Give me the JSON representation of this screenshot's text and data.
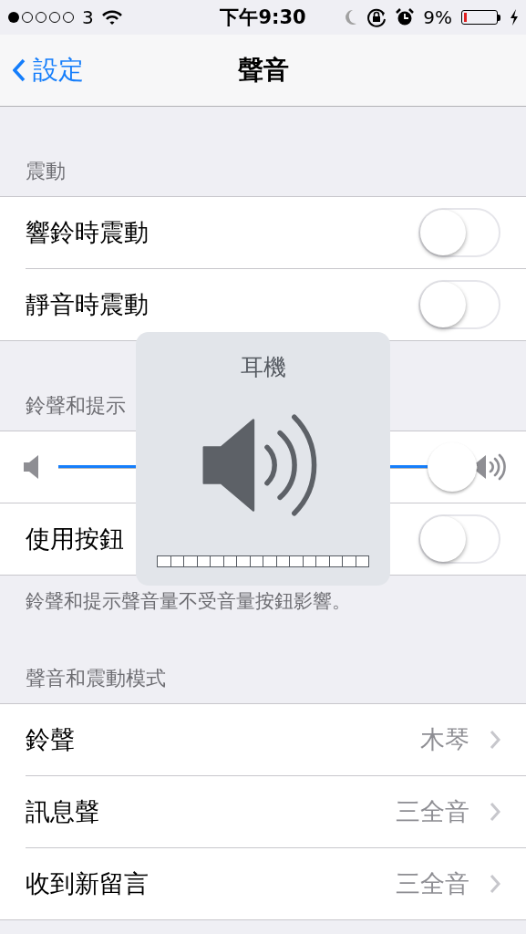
{
  "status_bar": {
    "carrier": "3",
    "time": "下午9:30",
    "battery_text": "9%",
    "charging": true
  },
  "nav": {
    "back": "設定",
    "title": "聲音"
  },
  "sections": [
    {
      "header": "震動",
      "rows": [
        {
          "kind": "toggle",
          "label": "響鈴時震動",
          "on": false
        },
        {
          "kind": "toggle",
          "label": "靜音時震動",
          "on": false
        }
      ]
    },
    {
      "header": "鈴聲和提示",
      "rows": [
        {
          "kind": "slider",
          "level": 0.94
        },
        {
          "kind": "toggle",
          "label": "使用按鈕",
          "on": false
        }
      ],
      "footer": "鈴聲和提示聲音量不受音量按鈕影響。"
    },
    {
      "header": "聲音和震動模式",
      "rows": [
        {
          "kind": "detail",
          "label": "鈴聲",
          "value": "木琴"
        },
        {
          "kind": "detail",
          "label": "訊息聲",
          "value": "三全音"
        },
        {
          "kind": "detail",
          "label": "收到新留言",
          "value": "三全音"
        }
      ]
    }
  ],
  "volume_hud": {
    "title": "耳機",
    "level": 0
  }
}
